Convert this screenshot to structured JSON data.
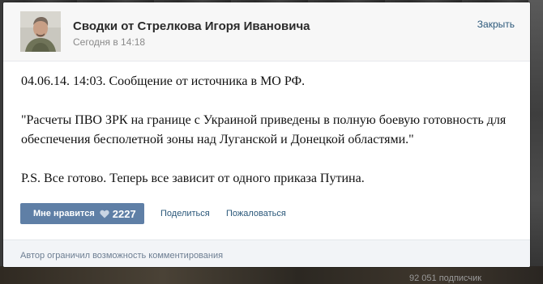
{
  "post": {
    "author": "Сводки от Стрелкова Игоря Ивановича",
    "date": "Сегодня в 14:18",
    "close_label": "Закрыть",
    "paragraphs": [
      "04.06.14. 14:03. Сообщение от источника в МО РФ.",
      "\"Расчеты ПВО ЗРК на границе с Украиной приведены в полную боевую готовность для обеспечения бесполетной зоны над Луганской и Донецкой областями.\"",
      "P.S. Все готово. Теперь все зависит от одного приказа Путина."
    ]
  },
  "actions": {
    "like_label": "Мне нравится",
    "like_count": "2227",
    "share_label": "Поделиться",
    "report_label": "Пожаловаться"
  },
  "footer": {
    "note": "Автор ограничил возможность комментирования"
  },
  "background": {
    "subscribers": "92 051 подписчик"
  },
  "colors": {
    "link": "#2b587a",
    "like_button": "#5f7fa6",
    "footer_bg": "#f2f4f7",
    "header_bg": "#f7f7f7"
  },
  "icons": {
    "avatar": "author-avatar",
    "heart": "heart-icon"
  }
}
